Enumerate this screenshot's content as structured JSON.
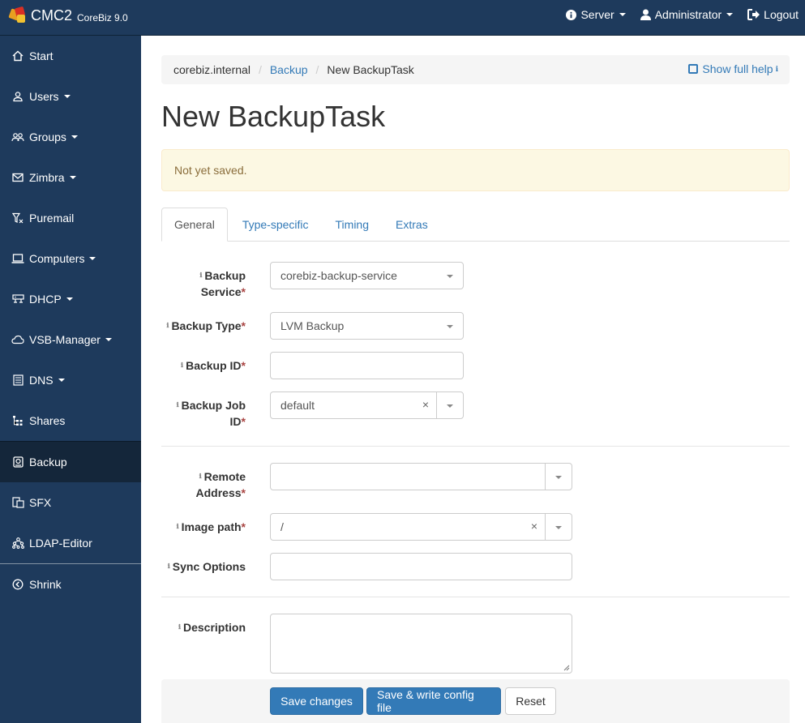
{
  "navbar": {
    "brand_name": "CMC2",
    "brand_version": "CoreBiz 9.0",
    "server_label": "Server",
    "user_label": "Administrator",
    "logout_label": "Logout"
  },
  "sidebar": {
    "items": [
      {
        "label": "Start",
        "icon": "home-icon"
      },
      {
        "label": "Users",
        "icon": "user-icon"
      },
      {
        "label": "Groups",
        "icon": "group-icon"
      },
      {
        "label": "Zimbra",
        "icon": "envelope-icon"
      },
      {
        "label": "Puremail",
        "icon": "filter-icon"
      },
      {
        "label": "Computers",
        "icon": "laptop-icon"
      },
      {
        "label": "DHCP",
        "icon": "network-icon"
      },
      {
        "label": "VSB-Manager",
        "icon": "cloud-icon"
      },
      {
        "label": "DNS",
        "icon": "list-icon"
      },
      {
        "label": "Shares",
        "icon": "tree-icon"
      },
      {
        "label": "Backup",
        "icon": "backup-icon"
      },
      {
        "label": "SFX",
        "icon": "files-icon"
      },
      {
        "label": "LDAP-Editor",
        "icon": "sitemap-icon"
      },
      {
        "label": "Shrink",
        "icon": "shrink-icon"
      }
    ],
    "active": "Backup"
  },
  "breadcrumb": {
    "items": [
      "corebiz.internal",
      "Backup",
      "New BackupTask"
    ],
    "help_label": "Show full help"
  },
  "page_title": "New BackupTask",
  "alert_text": "Not yet saved.",
  "tabs": [
    "General",
    "Type-specific",
    "Timing",
    "Extras"
  ],
  "form": {
    "backup_service": {
      "label_1": "Backup",
      "label_2": "Service",
      "value": "corebiz-backup-service"
    },
    "backup_type": {
      "label": "Backup Type",
      "value": "LVM Backup"
    },
    "backup_id": {
      "label": "Backup ID",
      "value": ""
    },
    "backup_job_id": {
      "label_1": "Backup Job",
      "label_2": "ID",
      "value": "default"
    },
    "remote_address": {
      "label_1": "Remote",
      "label_2": "Address",
      "value": ""
    },
    "image_path": {
      "label": "Image path",
      "value": "/"
    },
    "sync_options": {
      "label": "Sync Options",
      "value": ""
    },
    "description": {
      "label": "Description",
      "value": ""
    },
    "required_mark": "*",
    "clear_glyph": "×"
  },
  "buttons": {
    "save": "Save changes",
    "save_write": "Save & write config file",
    "reset": "Reset"
  }
}
